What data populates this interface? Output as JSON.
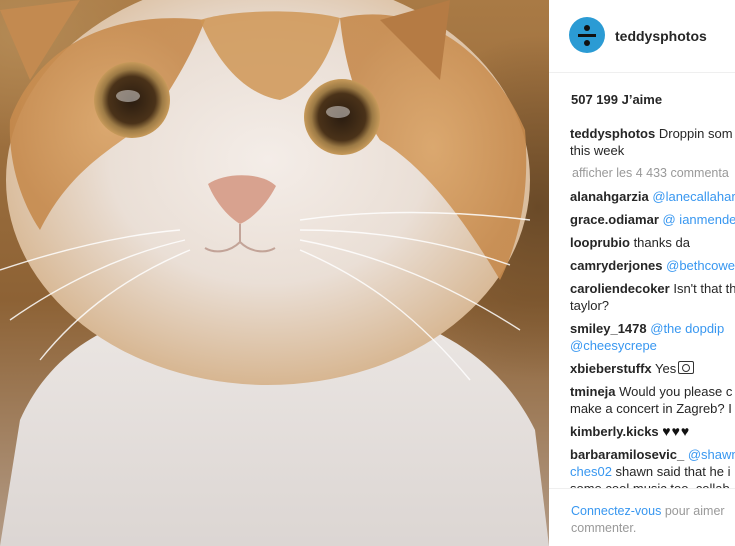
{
  "photo": {
    "alt_icon": "cat-photo"
  },
  "post": {
    "username": "teddysphotos",
    "avatar_icon": "divide-icon",
    "likes": "507 199 J’aime",
    "caption_user": "teddysphotos",
    "caption_text": "Droppin som",
    "caption_text2": "this week",
    "view_all": "afficher les 4 433 commenta"
  },
  "comments": [
    {
      "user": "alanahgarzia",
      "text": "",
      "mention": "@lanecallahar"
    },
    {
      "user": "grace.odiamar",
      "text": "",
      "mention": "@  ianmende"
    },
    {
      "user": "looprubio",
      "text": "thanks da",
      "mention": ""
    },
    {
      "user": "camryderjones",
      "text": "",
      "mention": "@bethcowe"
    },
    {
      "user": "caroliendecoker",
      "text": "Isn't that th",
      "line2": "taylor?"
    },
    {
      "user": "smiley_1478",
      "mention": "@the  dopdip",
      "line2_mention": "@cheesycrepe"
    },
    {
      "user": "xbieberstuffx",
      "text": "Yes"
    },
    {
      "user": "tmineja",
      "text": "Would you please c",
      "line2": "make a concert in Zagreb? I"
    },
    {
      "user": "kimberly.kicks",
      "text": "♥♥♥"
    },
    {
      "user": "barbaramilosevic_",
      "mention": "@shawn",
      "line2_mention": "ches02",
      "line2": "shawn said that he i",
      "line3": "some cool music too, collab"
    }
  ],
  "footer": {
    "login_link": "Connectez-vous",
    "login_text": "pour aimer",
    "login_text2": "commenter."
  }
}
